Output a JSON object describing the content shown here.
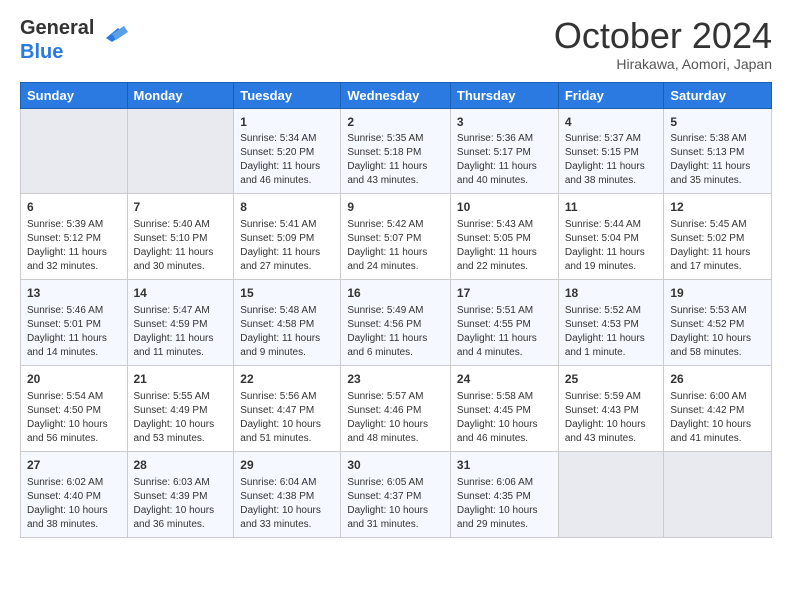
{
  "logo": {
    "line1": "General",
    "line2": "Blue"
  },
  "title": "October 2024",
  "subtitle": "Hirakawa, Aomori, Japan",
  "header_days": [
    "Sunday",
    "Monday",
    "Tuesday",
    "Wednesday",
    "Thursday",
    "Friday",
    "Saturday"
  ],
  "weeks": [
    [
      {
        "day": "",
        "empty": true
      },
      {
        "day": "",
        "empty": true
      },
      {
        "day": "1",
        "sunrise": "5:34 AM",
        "sunset": "5:20 PM",
        "daylight": "11 hours and 46 minutes."
      },
      {
        "day": "2",
        "sunrise": "5:35 AM",
        "sunset": "5:18 PM",
        "daylight": "11 hours and 43 minutes."
      },
      {
        "day": "3",
        "sunrise": "5:36 AM",
        "sunset": "5:17 PM",
        "daylight": "11 hours and 40 minutes."
      },
      {
        "day": "4",
        "sunrise": "5:37 AM",
        "sunset": "5:15 PM",
        "daylight": "11 hours and 38 minutes."
      },
      {
        "day": "5",
        "sunrise": "5:38 AM",
        "sunset": "5:13 PM",
        "daylight": "11 hours and 35 minutes."
      }
    ],
    [
      {
        "day": "6",
        "sunrise": "5:39 AM",
        "sunset": "5:12 PM",
        "daylight": "11 hours and 32 minutes."
      },
      {
        "day": "7",
        "sunrise": "5:40 AM",
        "sunset": "5:10 PM",
        "daylight": "11 hours and 30 minutes."
      },
      {
        "day": "8",
        "sunrise": "5:41 AM",
        "sunset": "5:09 PM",
        "daylight": "11 hours and 27 minutes."
      },
      {
        "day": "9",
        "sunrise": "5:42 AM",
        "sunset": "5:07 PM",
        "daylight": "11 hours and 24 minutes."
      },
      {
        "day": "10",
        "sunrise": "5:43 AM",
        "sunset": "5:05 PM",
        "daylight": "11 hours and 22 minutes."
      },
      {
        "day": "11",
        "sunrise": "5:44 AM",
        "sunset": "5:04 PM",
        "daylight": "11 hours and 19 minutes."
      },
      {
        "day": "12",
        "sunrise": "5:45 AM",
        "sunset": "5:02 PM",
        "daylight": "11 hours and 17 minutes."
      }
    ],
    [
      {
        "day": "13",
        "sunrise": "5:46 AM",
        "sunset": "5:01 PM",
        "daylight": "11 hours and 14 minutes."
      },
      {
        "day": "14",
        "sunrise": "5:47 AM",
        "sunset": "4:59 PM",
        "daylight": "11 hours and 11 minutes."
      },
      {
        "day": "15",
        "sunrise": "5:48 AM",
        "sunset": "4:58 PM",
        "daylight": "11 hours and 9 minutes."
      },
      {
        "day": "16",
        "sunrise": "5:49 AM",
        "sunset": "4:56 PM",
        "daylight": "11 hours and 6 minutes."
      },
      {
        "day": "17",
        "sunrise": "5:51 AM",
        "sunset": "4:55 PM",
        "daylight": "11 hours and 4 minutes."
      },
      {
        "day": "18",
        "sunrise": "5:52 AM",
        "sunset": "4:53 PM",
        "daylight": "11 hours and 1 minute."
      },
      {
        "day": "19",
        "sunrise": "5:53 AM",
        "sunset": "4:52 PM",
        "daylight": "10 hours and 58 minutes."
      }
    ],
    [
      {
        "day": "20",
        "sunrise": "5:54 AM",
        "sunset": "4:50 PM",
        "daylight": "10 hours and 56 minutes."
      },
      {
        "day": "21",
        "sunrise": "5:55 AM",
        "sunset": "4:49 PM",
        "daylight": "10 hours and 53 minutes."
      },
      {
        "day": "22",
        "sunrise": "5:56 AM",
        "sunset": "4:47 PM",
        "daylight": "10 hours and 51 minutes."
      },
      {
        "day": "23",
        "sunrise": "5:57 AM",
        "sunset": "4:46 PM",
        "daylight": "10 hours and 48 minutes."
      },
      {
        "day": "24",
        "sunrise": "5:58 AM",
        "sunset": "4:45 PM",
        "daylight": "10 hours and 46 minutes."
      },
      {
        "day": "25",
        "sunrise": "5:59 AM",
        "sunset": "4:43 PM",
        "daylight": "10 hours and 43 minutes."
      },
      {
        "day": "26",
        "sunrise": "6:00 AM",
        "sunset": "4:42 PM",
        "daylight": "10 hours and 41 minutes."
      }
    ],
    [
      {
        "day": "27",
        "sunrise": "6:02 AM",
        "sunset": "4:40 PM",
        "daylight": "10 hours and 38 minutes."
      },
      {
        "day": "28",
        "sunrise": "6:03 AM",
        "sunset": "4:39 PM",
        "daylight": "10 hours and 36 minutes."
      },
      {
        "day": "29",
        "sunrise": "6:04 AM",
        "sunset": "4:38 PM",
        "daylight": "10 hours and 33 minutes."
      },
      {
        "day": "30",
        "sunrise": "6:05 AM",
        "sunset": "4:37 PM",
        "daylight": "10 hours and 31 minutes."
      },
      {
        "day": "31",
        "sunrise": "6:06 AM",
        "sunset": "4:35 PM",
        "daylight": "10 hours and 29 minutes."
      },
      {
        "day": "",
        "empty": true
      },
      {
        "day": "",
        "empty": true
      }
    ]
  ],
  "labels": {
    "sunrise": "Sunrise:",
    "sunset": "Sunset:",
    "daylight": "Daylight:"
  }
}
